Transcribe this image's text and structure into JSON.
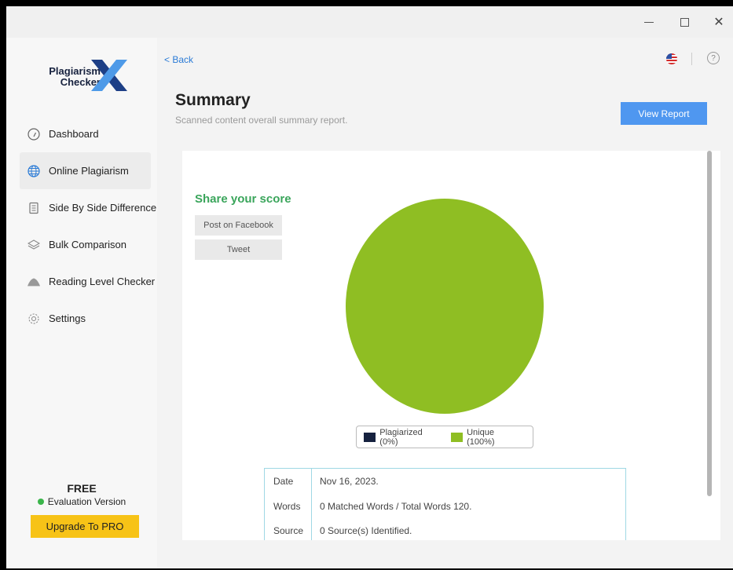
{
  "window": {
    "controls": {
      "minimize": "—",
      "maximize": "☐",
      "close": "✕"
    }
  },
  "sidebar": {
    "logo": {
      "line1": "Plagiarism",
      "line2": "Checker",
      "mark": "X"
    },
    "items": [
      {
        "label": "Dashboard",
        "icon": "gauge-icon",
        "active": false
      },
      {
        "label": "Online Plagiarism",
        "icon": "globe-icon",
        "active": true
      },
      {
        "label": "Side By Side Difference",
        "icon": "document-icon",
        "active": false
      },
      {
        "label": "Bulk Comparison",
        "icon": "layers-icon",
        "active": false
      },
      {
        "label": "Reading Level Checker",
        "icon": "mountain-icon",
        "active": false
      },
      {
        "label": "Settings",
        "icon": "gear-icon",
        "active": false
      }
    ],
    "plan": {
      "title": "FREE",
      "status": "Evaluation Version",
      "status_color": "#3ab54a"
    },
    "upgrade_label": "Upgrade To PRO"
  },
  "header": {
    "back_label": "< Back",
    "help_glyph": "?",
    "title": "Summary",
    "subtitle": "Scanned content overall summary report.",
    "view_report_label": "View Report"
  },
  "share": {
    "title": "Share your score",
    "facebook_label": "Post on Facebook",
    "tweet_label": "Tweet"
  },
  "chart_data": {
    "type": "pie",
    "categories": [
      "Plagiarized (0%)",
      "Unique (100%)"
    ],
    "values": [
      0,
      100
    ],
    "colors": [
      "#16223f",
      "#8fbe23"
    ],
    "legend": "bottom"
  },
  "legend": {
    "plagiarized": "Plagiarized (0%)",
    "unique": "Unique (100%)"
  },
  "summary_table": [
    {
      "key": "Date",
      "value": "Nov 16, 2023."
    },
    {
      "key": "Words",
      "value": "0 Matched Words / Total Words 120."
    },
    {
      "key": "Source",
      "value": "0 Source(s) Identified."
    }
  ]
}
